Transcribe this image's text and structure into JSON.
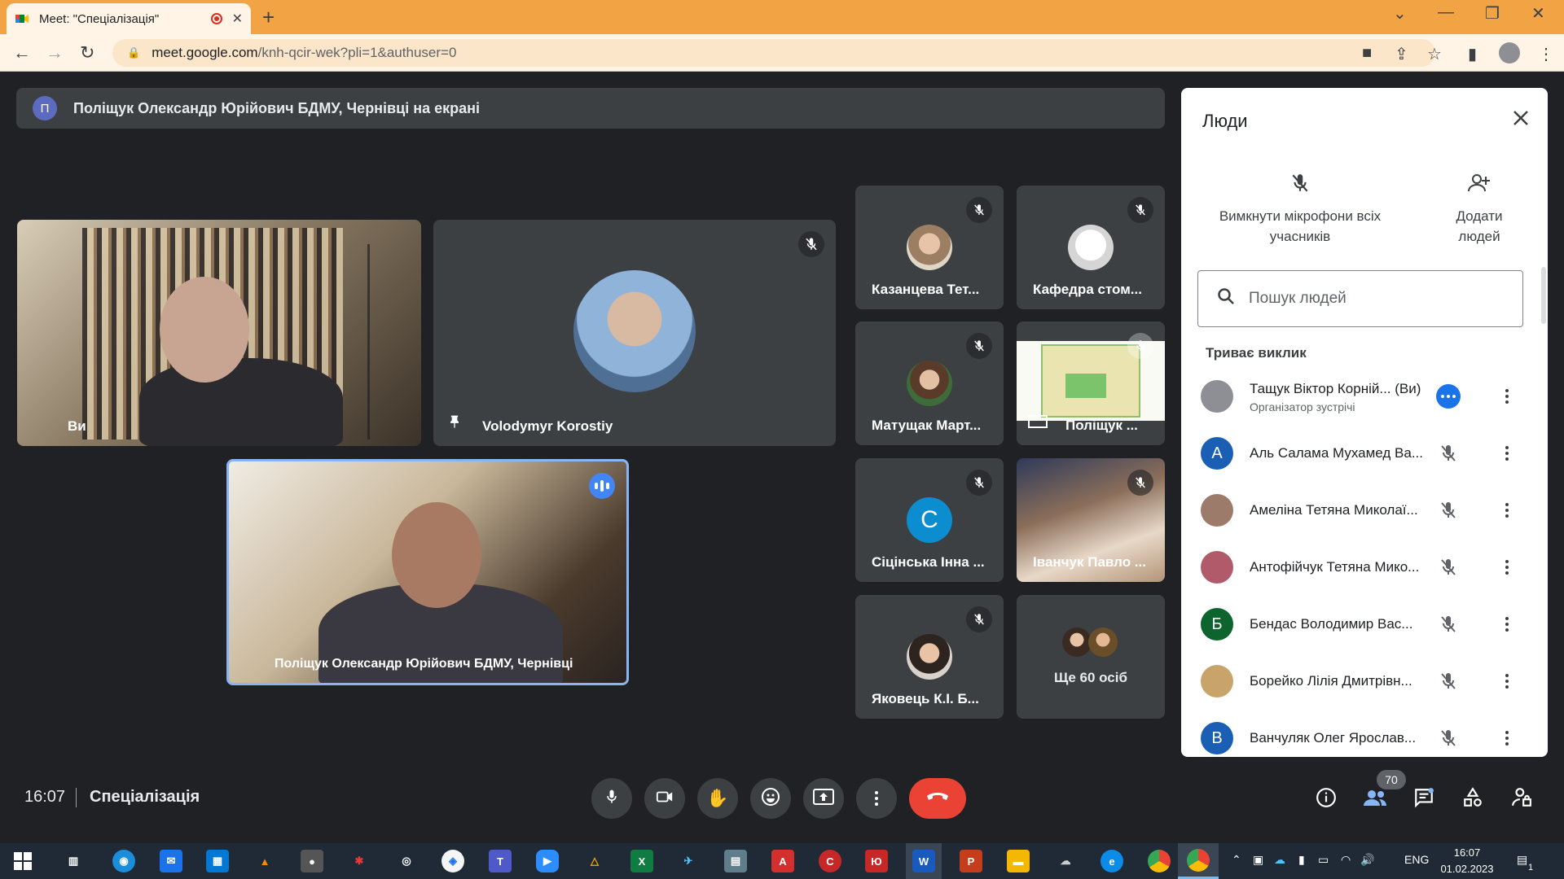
{
  "browser": {
    "tab_title": "Meet: \"Спеціалізація\"",
    "url_host": "meet.google.com",
    "url_path": "/knh-qcir-wek?pli=1&authuser=0"
  },
  "banner": {
    "avatar_letter": "П",
    "text": "Поліщук Олександр Юрійович БДМУ, Чернівці на екрані"
  },
  "tiles": {
    "self_label": "Ви",
    "korostiy": "Volodymyr Korostiy",
    "presenter": "Поліщук Олександр Юрійович БДМУ, Чернівці",
    "kazantseva": "Казанцева Тет...",
    "kafedra": "Кафедра стом...",
    "matushchak": "Матущак Март...",
    "polishchuk_small": "Поліщук ...",
    "sitsinska": "Сіцінська Інна ...",
    "sitsinska_letter": "С",
    "ivanchuk": "Іванчук Павло ...",
    "yakovets": "Яковець К.І. Б...",
    "more_people": "Ще 60 осіб"
  },
  "bottom": {
    "time": "16:07",
    "meeting_name": "Спеціалізація",
    "participants_count": "70"
  },
  "people_panel": {
    "title": "Люди",
    "mute_all_label": "Вимкнути мікрофони всіх учасників",
    "add_people_label": "Додати людей",
    "search_placeholder": "Пошук людей",
    "section_title": "Триває виклик",
    "participants": [
      {
        "name": "Тащук Віктор Корній... (Ви)",
        "sub": "Організатор зустрічі",
        "letter": "",
        "color": "#8d8f94"
      },
      {
        "name": "Аль Салама Мухамед Ва...",
        "letter": "А",
        "color": "#1a5fb4"
      },
      {
        "name": "Амеліна Тетяна Миколаї...",
        "letter": "",
        "color": "#9c7b6a"
      },
      {
        "name": "Антофійчук Тетяна Мико...",
        "letter": "",
        "color": "#b05a6a"
      },
      {
        "name": "Бендас Володимир Вас...",
        "letter": "Б",
        "color": "#0d652d"
      },
      {
        "name": "Борейко Лілія Дмитрівн...",
        "letter": "",
        "color": "#c9a46a"
      },
      {
        "name": "Ванчуляк Олег Ярослав...",
        "letter": "В",
        "color": "#1a5fb4"
      }
    ]
  },
  "taskbar": {
    "lang": "ENG",
    "time": "16:07",
    "date": "01.02.2023",
    "notif_count": "1"
  }
}
